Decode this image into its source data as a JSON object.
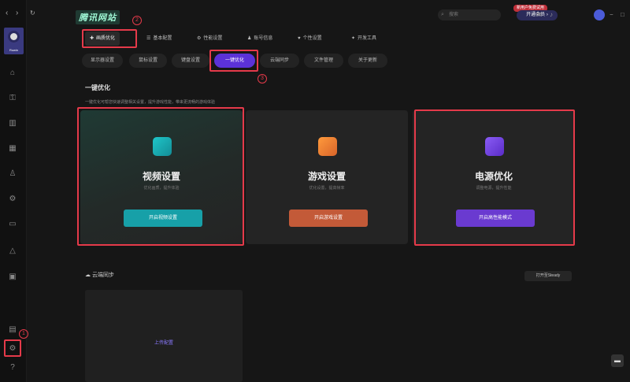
{
  "nav": {
    "back": "‹",
    "forward": "›",
    "refresh": "↻"
  },
  "avatar_label": "Ruwin",
  "brand": "腾讯网站",
  "search": {
    "placeholder": "搜索"
  },
  "promo_badge": "新用户免费试用",
  "vip_label": "开通会员 ›",
  "top_tabs": [
    {
      "icon": "✚",
      "label": "画质优化"
    },
    {
      "icon": "☰",
      "label": "基本配置"
    },
    {
      "icon": "⚙",
      "label": "性能设置"
    },
    {
      "icon": "♟",
      "label": "账号信息"
    },
    {
      "icon": "♥",
      "label": "个性设置"
    },
    {
      "icon": "✦",
      "label": "开发工具"
    }
  ],
  "sub_tabs": [
    "显示器设置",
    "鼠标设置",
    "键盘设置",
    "一键优化",
    "云端同步",
    "文件管理",
    "关于更新"
  ],
  "section": {
    "title": "一键优化",
    "desc": "一键优化可帮您快速调整相关设置，提升游戏性能，带来更流畅的游戏体验"
  },
  "cards": [
    {
      "title": "视频设置",
      "subtitle": "优化画质，提升体验",
      "button": "开启视频设置",
      "color": "#17a0a8"
    },
    {
      "title": "游戏设置",
      "subtitle": "优化设置，提高帧率",
      "button": "开启游戏设置",
      "color": "#c35a38"
    },
    {
      "title": "电源优化",
      "subtitle": "调整电源，提升性能",
      "button": "开启高性能模式",
      "color": "#6a3ad0"
    }
  ],
  "cloud": {
    "title": "云端同步",
    "button": "打开至Steady",
    "panel_text": "上传配置"
  },
  "markers": [
    "1",
    "2",
    "3"
  ],
  "chat_icon": "▬"
}
